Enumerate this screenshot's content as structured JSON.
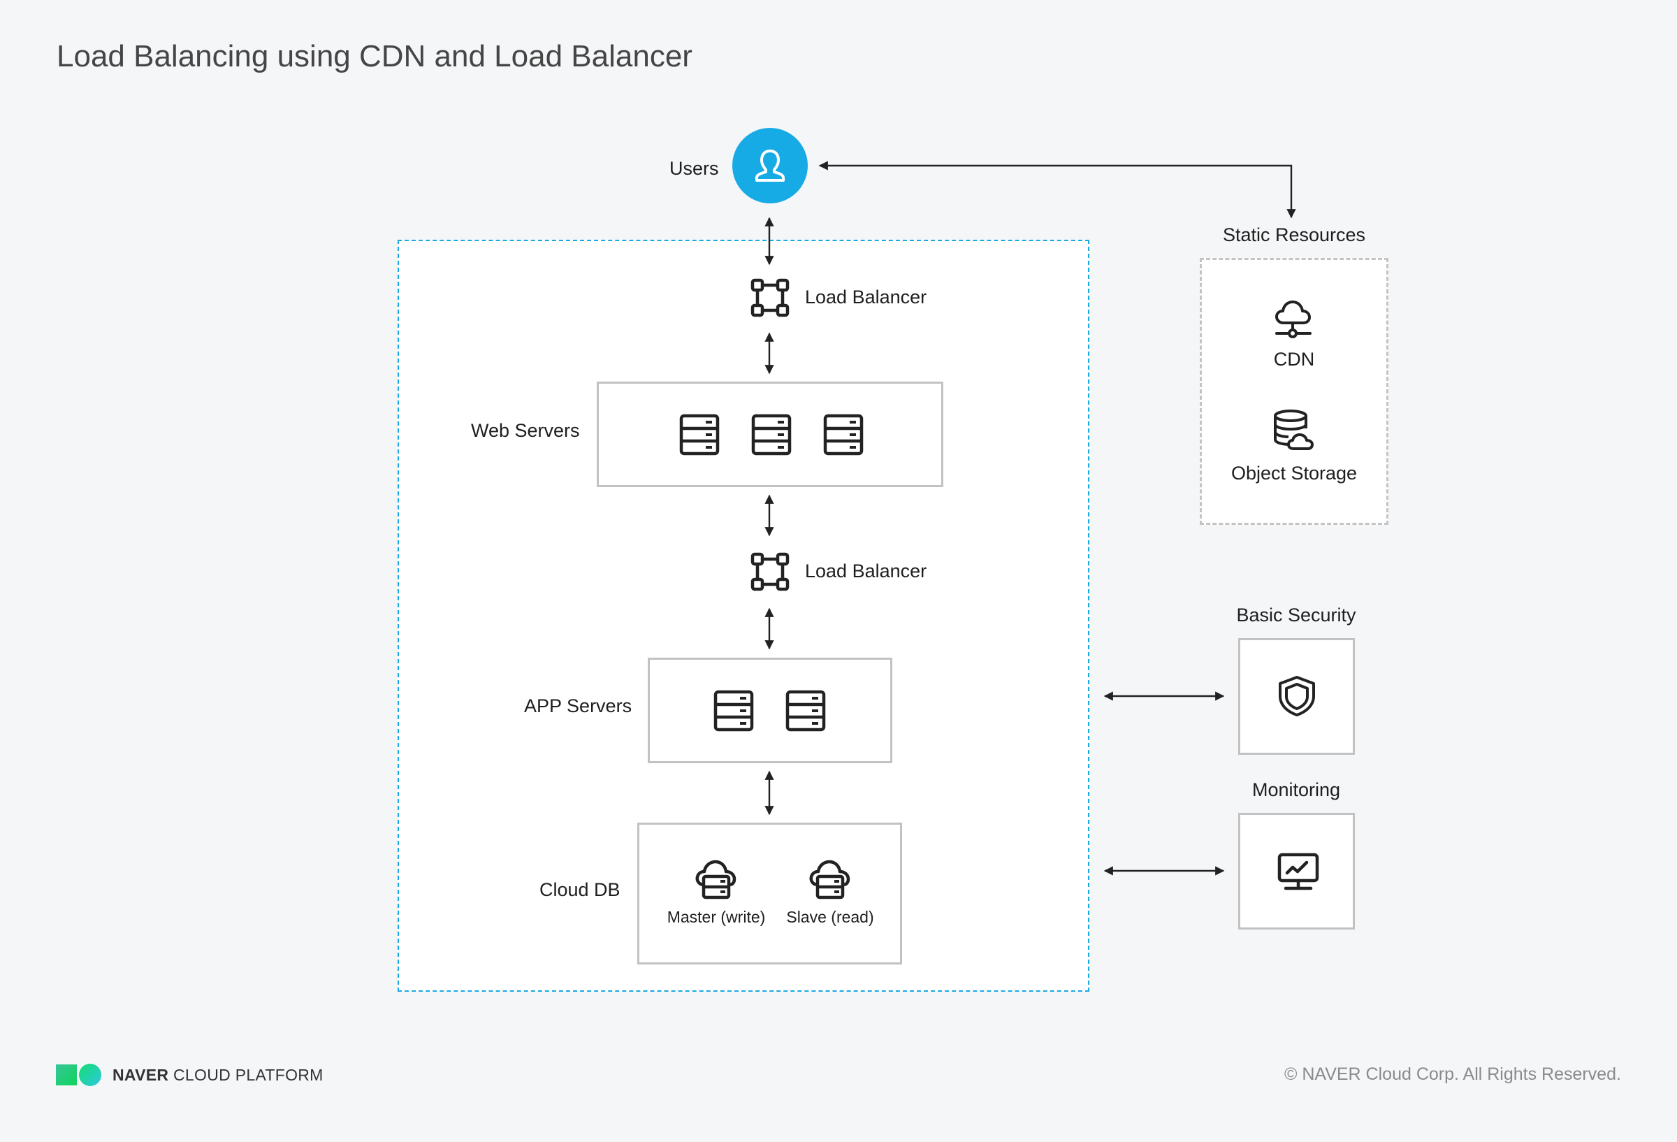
{
  "title": "Load Balancing using CDN and Load Balancer",
  "colors": {
    "accent": "#17abe5",
    "zone_border": "#1aa9e1",
    "box_border": "#c2c2c2",
    "background": "#f5f6f8",
    "icon": "#222222"
  },
  "users": {
    "label": "Users",
    "icon": "user-icon"
  },
  "main_zone": {
    "load_balancer_top": {
      "label": "Load Balancer",
      "icon": "load-balancer-icon"
    },
    "web_servers": {
      "label": "Web Servers",
      "count": 3,
      "icon": "server-icon"
    },
    "load_balancer_mid": {
      "label": "Load Balancer",
      "icon": "load-balancer-icon"
    },
    "app_servers": {
      "label": "APP Servers",
      "count": 2,
      "icon": "server-icon"
    },
    "cloud_db": {
      "label": "Cloud DB",
      "nodes": [
        {
          "label": "Master (write)",
          "icon": "cloud-db-icon"
        },
        {
          "label": "Slave (read)",
          "icon": "cloud-db-icon"
        }
      ]
    }
  },
  "static_resources": {
    "label": "Static Resources",
    "items": [
      {
        "label": "CDN",
        "icon": "cdn-icon"
      },
      {
        "label": "Object Storage",
        "icon": "object-storage-icon"
      }
    ]
  },
  "basic_security": {
    "label": "Basic Security",
    "icon": "shield-icon"
  },
  "monitoring": {
    "label": "Monitoring",
    "icon": "monitor-chart-icon"
  },
  "footer": {
    "brand_bold": "NAVER",
    "brand_rest": "CLOUD PLATFORM",
    "copyright": "© NAVER Cloud Corp. All Rights Reserved."
  }
}
